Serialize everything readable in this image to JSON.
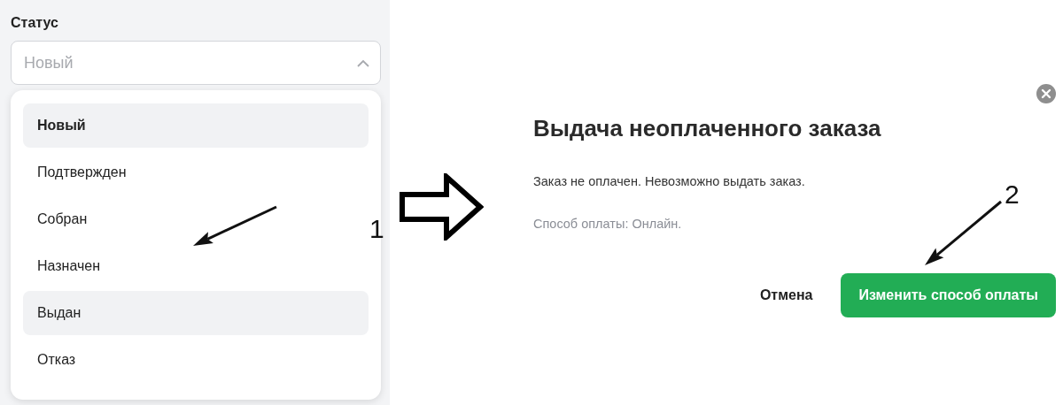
{
  "status_field": {
    "label": "Статус",
    "placeholder": "Новый",
    "expanded": true,
    "options": [
      {
        "label": "Новый",
        "selected": true,
        "hovered": false
      },
      {
        "label": "Подтвержден",
        "selected": false,
        "hovered": false
      },
      {
        "label": "Собран",
        "selected": false,
        "hovered": false
      },
      {
        "label": "Назначен",
        "selected": false,
        "hovered": false
      },
      {
        "label": "Выдан",
        "selected": false,
        "hovered": true
      },
      {
        "label": "Отказ",
        "selected": false,
        "hovered": false
      }
    ]
  },
  "dialog": {
    "title": "Выдача неоплаченного заказа",
    "message": "Заказ не оплачен. Невозможно выдать заказ.",
    "note": "Способ оплаты: Онлайн.",
    "buttons": [
      {
        "label": "Отмена",
        "kind": "text"
      },
      {
        "label": "Изменить способ оплаты",
        "kind": "primary"
      }
    ]
  },
  "annotations": [
    {
      "label": "1"
    },
    {
      "label": "2"
    }
  ]
}
